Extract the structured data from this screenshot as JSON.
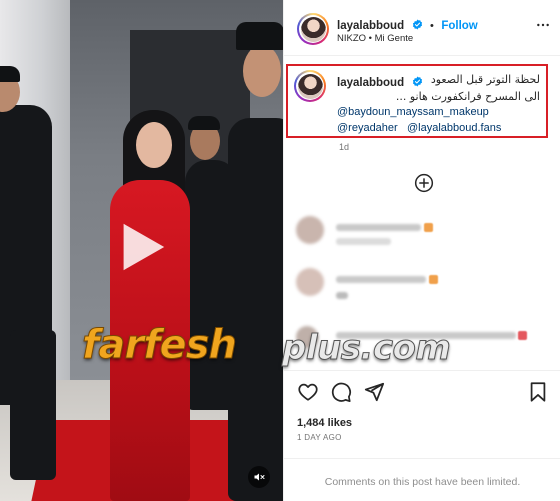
{
  "post": {
    "username": "layalabboud",
    "follow_label": "Follow",
    "audio": "NIKZO • Mi Gente",
    "caption_line1": "لحظة التوتر قبل الصعود",
    "caption_line2": "... الى المسرح فرانكفورت هانو",
    "mention1": "@baydoun_mayssam_makeup",
    "mention2": "@reyadaher",
    "mention3": "@layalabboud.fans",
    "age": "1d",
    "likes": "1,484 likes",
    "date": "1 DAY AGO",
    "comments_limited": "Comments on this post have been limited."
  },
  "watermark": {
    "part1": "farfesh",
    "part2": "plus.com"
  },
  "icons": {
    "verified": "verified-badge-icon",
    "more": "more-options-icon",
    "load_more": "plus-circle-icon",
    "like": "heart-icon",
    "comment": "comment-icon",
    "share": "send-icon",
    "save": "bookmark-icon",
    "play": "play-icon",
    "mute": "muted-speaker-icon"
  },
  "colors": {
    "follow": "#0095f6",
    "highlight_box": "#d81f26",
    "verified": "#0095f6",
    "dress": "#c4141a"
  }
}
